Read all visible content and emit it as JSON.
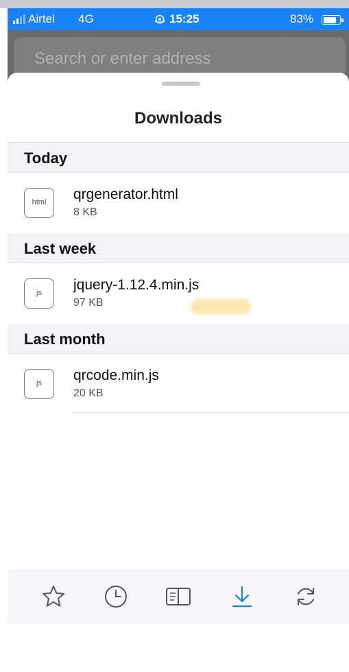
{
  "status_bar": {
    "carrier": "Airtel",
    "network": "4G",
    "time": "15:25",
    "battery_percent": "83%",
    "battery_level": 0.83,
    "signal_bars_active": 2,
    "signal_bars_total": 4
  },
  "address_bar": {
    "placeholder": "Search or enter address"
  },
  "downloads": {
    "title": "Downloads",
    "sections": [
      {
        "header": "Today",
        "files": [
          {
            "name": "qrgenerator.html",
            "size": "8 KB",
            "icon_label": "html"
          }
        ]
      },
      {
        "header": "Last week",
        "files": [
          {
            "name": "jquery-1.12.4.min.js",
            "size": "97 KB",
            "icon_label": "js"
          }
        ]
      },
      {
        "header": "Last month",
        "files": [
          {
            "name": "qrcode.min.js",
            "size": "20 KB",
            "icon_label": "js"
          }
        ]
      }
    ]
  },
  "toolbar": {
    "items": [
      {
        "icon": "star-icon",
        "active": false
      },
      {
        "icon": "clock-icon",
        "active": false
      },
      {
        "icon": "book-icon",
        "active": false
      },
      {
        "icon": "download-icon",
        "active": true
      },
      {
        "icon": "sync-icon",
        "active": false
      }
    ]
  },
  "colors": {
    "status_bar": "#1a82f7",
    "accent": "#1a82f7",
    "icon_inactive": "#555555",
    "section_background": "#f2f2f7"
  }
}
